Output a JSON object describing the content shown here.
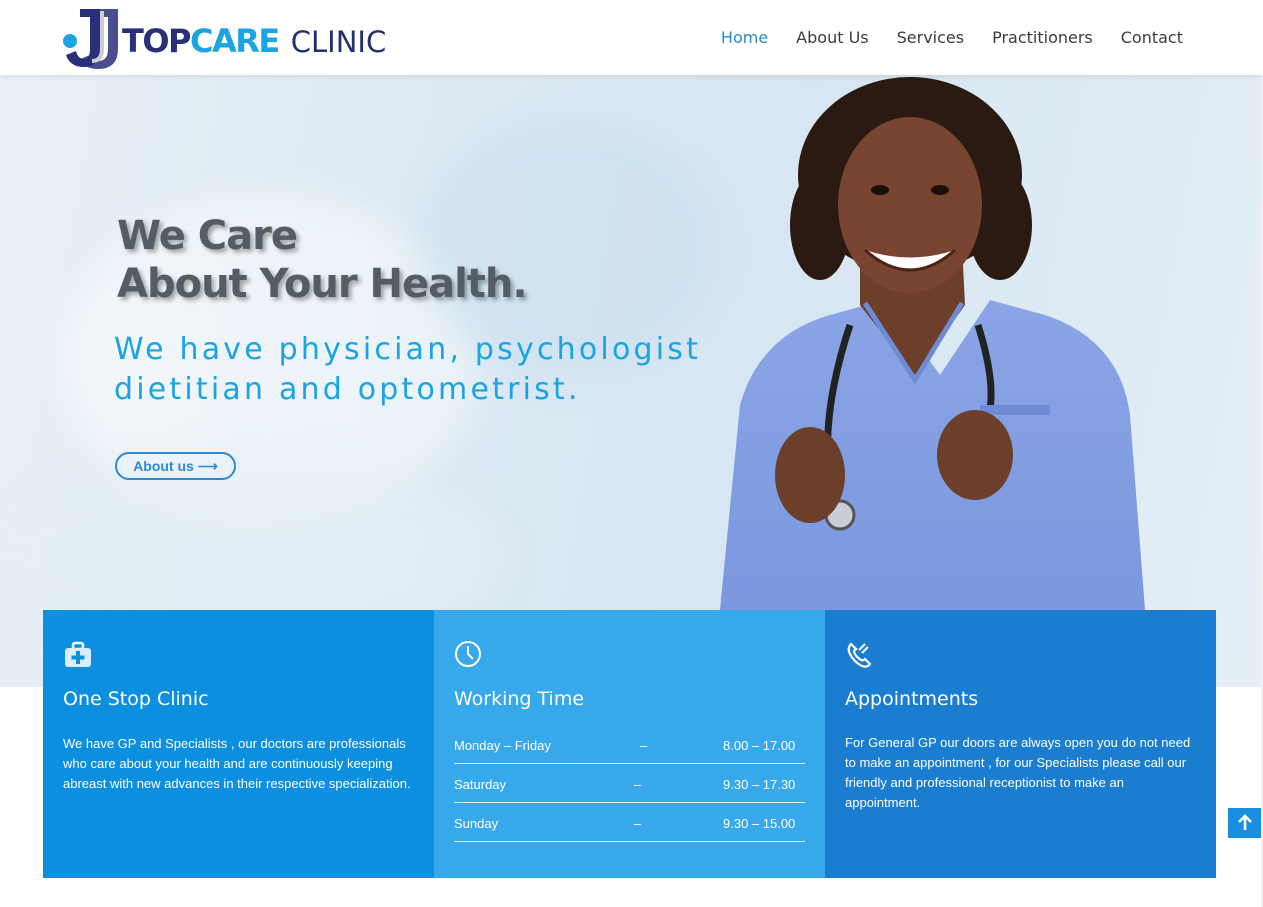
{
  "brand": {
    "name_top": "TOP",
    "name_care": "CARE",
    "name_clinic": "CLINIC"
  },
  "nav": {
    "items": [
      {
        "label": "Home",
        "active": true
      },
      {
        "label": "About Us",
        "active": false
      },
      {
        "label": "Services",
        "active": false
      },
      {
        "label": "Practitioners",
        "active": false
      },
      {
        "label": "Contact",
        "active": false
      }
    ]
  },
  "hero": {
    "title_line1": "We Care",
    "title_line2": "About Your Health.",
    "subtitle_line1": "We have physician, psychologist",
    "subtitle_line2": "dietitian and optometrist.",
    "button_label": "About us ⟶"
  },
  "panels": {
    "clinic": {
      "icon": "medical-kit-icon",
      "title": "One Stop Clinic",
      "text": "We have GP and Specialists , our doctors are professionals who care about your health and are continuously keeping abreast with new advances in their respective specialization."
    },
    "working_time": {
      "icon": "clock-icon",
      "title": "Working Time",
      "rows": [
        {
          "day": "Monday – Friday",
          "dash": "–",
          "time": "8.00 – 17.00"
        },
        {
          "day": "Saturday",
          "dash": "–",
          "time": "9.30 – 17.30"
        },
        {
          "day": "Sunday",
          "dash": "–",
          "time": "9.30 – 15.00"
        }
      ]
    },
    "appointments": {
      "icon": "phone-icon",
      "title": "Appointments",
      "text": "For General GP our doors are always open you do not need to make an appointment , for our Specialists please call our friendly and professional receptionist to make an appointment."
    }
  },
  "colors": {
    "brand_navy": "#2a2f7a",
    "brand_blue": "#1ba3e4",
    "panel_1": "#0b8fde",
    "panel_2": "#37a8ea",
    "panel_3": "#1a7dd0",
    "nav_active": "#2a8ad6"
  },
  "scroll_top": {
    "icon": "arrow-up-icon"
  }
}
